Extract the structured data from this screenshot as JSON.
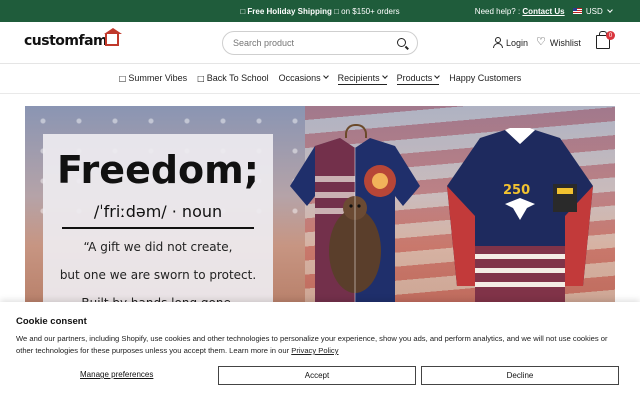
{
  "announcement": {
    "promo_icon": "□",
    "promo_bold": "Free Holiday Shipping",
    "promo_icon2": "□",
    "promo_rest": "on $150+ orders",
    "help_text": "Need help? :",
    "contact_link": "Contact Us",
    "currency": "USD"
  },
  "header": {
    "logo": "customfam",
    "search_placeholder": "Search product",
    "login": "Login",
    "wishlist": "Wishlist",
    "cart_count": "0"
  },
  "nav": {
    "items": [
      {
        "glyph": "□",
        "label": "Summer Vibes"
      },
      {
        "glyph": "□",
        "label": "Back To School"
      },
      {
        "label": "Occasions"
      },
      {
        "label": "Recipients"
      },
      {
        "label": "Products"
      },
      {
        "label": "Happy Customers"
      }
    ]
  },
  "hero": {
    "word": "Freedom;",
    "pronunciation": "/ˈfriːdəm/ · noun",
    "line1": "“A gift we did not create,",
    "line2": "but one we are sworn to protect.",
    "line3": "Built by hands long gone,",
    "shirt_badge": "250"
  },
  "consent": {
    "title": "Cookie consent",
    "body": "We and our partners, including Shopify, use cookies and other technologies to personalize your experience, show you ads, and perform analytics, and we will not use cookies or other technologies for these purposes unless you accept them. Learn more in our",
    "policy_link": "Privacy Policy",
    "manage": "Manage preferences",
    "accept": "Accept",
    "decline": "Decline"
  }
}
